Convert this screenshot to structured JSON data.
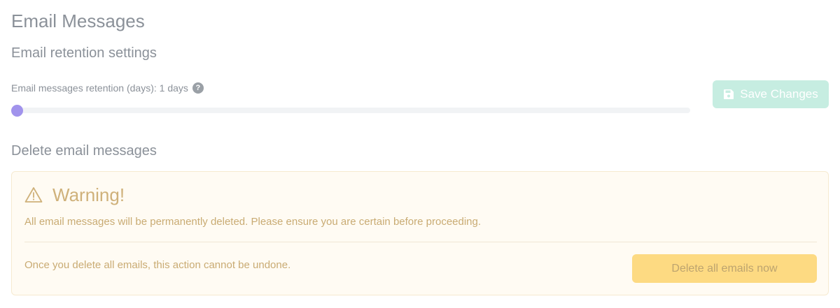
{
  "page": {
    "title": "Email Messages"
  },
  "retention": {
    "section_title": "Email retention settings",
    "label": "Email messages retention (days): 1 days",
    "help_glyph": "?",
    "help_icon": "question-circle-icon",
    "slider_value": 1,
    "slider_fraction": 0.0,
    "save_label": "Save Changes",
    "save_icon": "floppy-disk-icon",
    "colors": {
      "slider_thumb": "#a193ec",
      "save_button": "#c6ede1"
    }
  },
  "delete": {
    "section_title": "Delete email messages",
    "warning_icon": "warning-triangle-icon",
    "warning_title": "Warning!",
    "warning_text": "All email messages will be permanently deleted. Please ensure you are certain before proceeding.",
    "undo_text": "Once you delete all emails, this action cannot be undone.",
    "button_label": "Delete all emails now",
    "colors": {
      "panel_bg": "#fffbf3",
      "warning_text": "#c9ab73",
      "delete_button": "#fdda82"
    }
  }
}
